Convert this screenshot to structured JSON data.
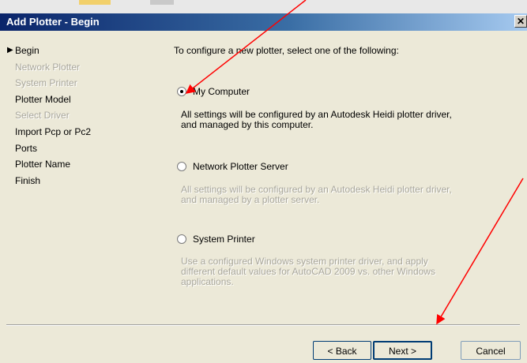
{
  "window": {
    "title": "Add Plotter - Begin",
    "close_glyph": "✕"
  },
  "steps": [
    {
      "label": "Begin",
      "enabled": true,
      "current": true
    },
    {
      "label": "Network Plotter",
      "enabled": false
    },
    {
      "label": "System Printer",
      "enabled": false
    },
    {
      "label": "Plotter Model",
      "enabled": true
    },
    {
      "label": "Select Driver",
      "enabled": false
    },
    {
      "label": "Import Pcp or Pc2",
      "enabled": true
    },
    {
      "label": "Ports",
      "enabled": true
    },
    {
      "label": "Plotter Name",
      "enabled": true
    },
    {
      "label": "Finish",
      "enabled": true
    }
  ],
  "heading": "To configure a new plotter, select one of the following:",
  "options": [
    {
      "label": "My Computer",
      "checked": true,
      "description": "All settings will be configured by an Autodesk Heidi plotter driver, and managed by this computer."
    },
    {
      "label": "Network Plotter Server",
      "checked": false,
      "description": "All settings will be configured by an Autodesk Heidi plotter driver, and managed by a plotter server."
    },
    {
      "label": "System Printer",
      "checked": false,
      "description": "Use a configured Windows system printer driver, and apply different default values for AutoCAD 2009 vs. other Windows applications."
    }
  ],
  "buttons": {
    "back": "< Back",
    "next": "Next >",
    "cancel": "Cancel"
  },
  "colors": {
    "titlebar_start": "#0a246a",
    "titlebar_end": "#a6caf0",
    "dialog_bg": "#ece9d8",
    "annotation_arrow": "#ff0000"
  }
}
